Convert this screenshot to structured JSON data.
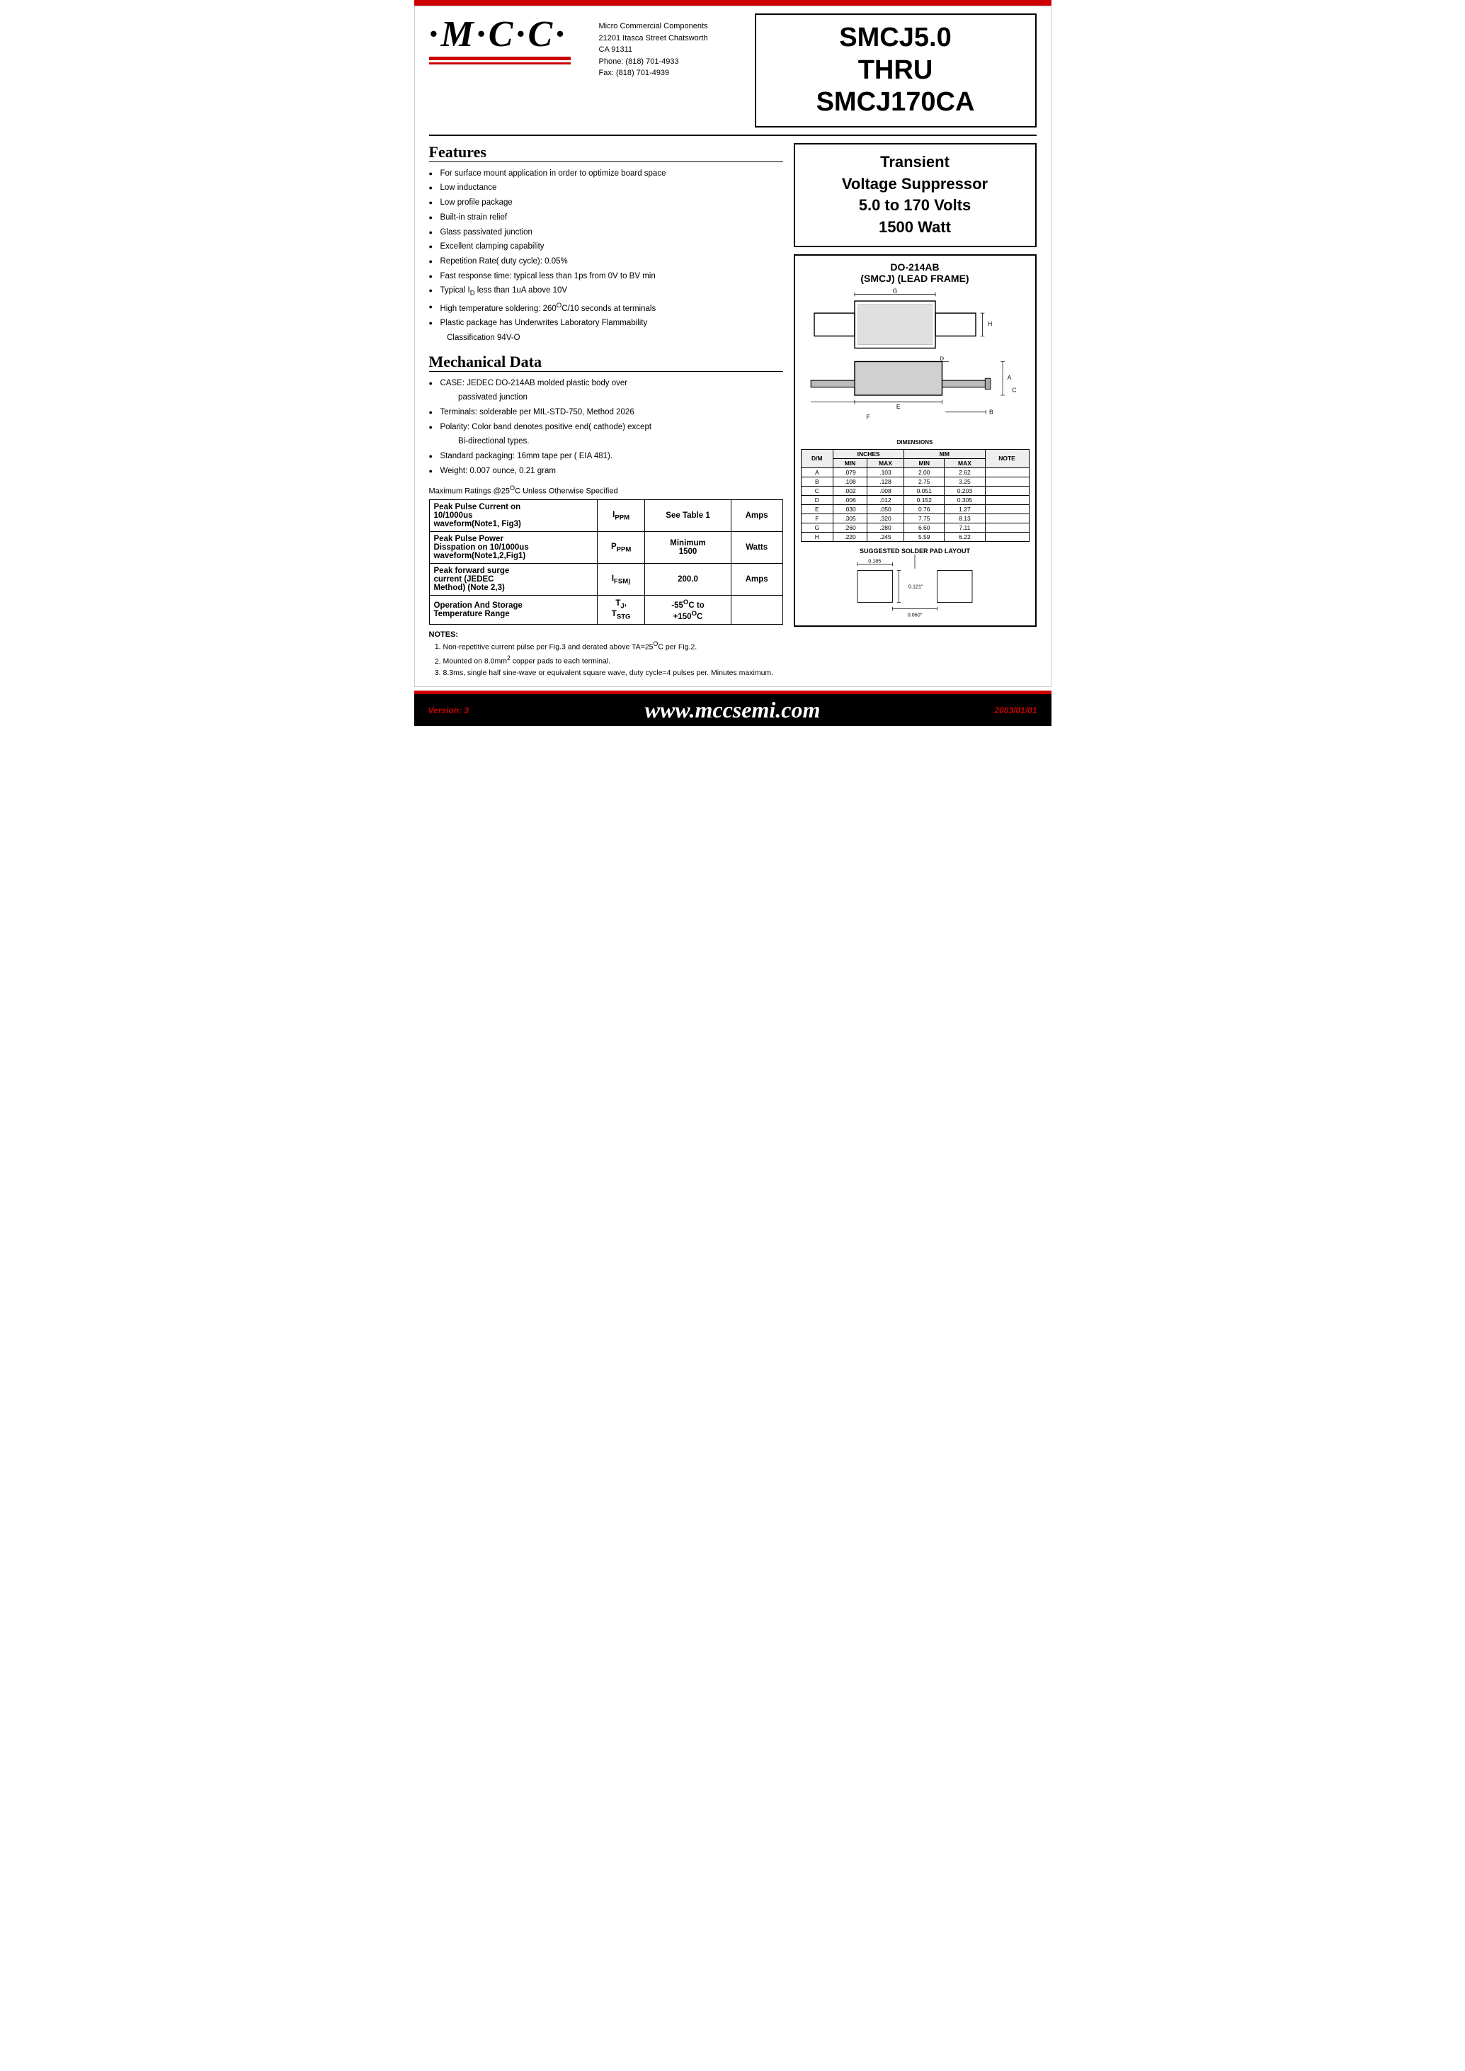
{
  "top_bar": {},
  "header": {
    "logo": "M·C·C·",
    "company_name": "Micro Commercial Components",
    "address1": "21201 Itasca Street Chatsworth",
    "address2": "CA 91311",
    "phone": "Phone: (818) 701-4933",
    "fax": "Fax:    (818) 701-4939",
    "part_number": "SMCJ5.0\nTHRU\nSMCJ170CA"
  },
  "product_description": {
    "line1": "Transient",
    "line2": "Voltage Suppressor",
    "line3": "5.0 to 170 Volts",
    "line4": "1500 Watt"
  },
  "package_info": {
    "title1": "DO-214AB",
    "title2": "(SMCJ) (LEAD FRAME)"
  },
  "features": {
    "section_title": "Features",
    "items": [
      "For surface mount application in order to optimize board space",
      "Low inductance",
      "Low profile package",
      "Built-in strain relief",
      "Glass passivated junction",
      "Excellent clamping capability",
      "Repetition Rate( duty cycle): 0.05%",
      "Fast response time: typical less than 1ps from 0V to BV min",
      "Typical I₀ less than 1uA above 10V",
      "High temperature soldering: 260°C/10 seconds at terminals",
      "Plastic package has Underwrites Laboratory Flammability Classification 94V-O"
    ]
  },
  "mechanical_data": {
    "section_title": "Mechanical Data",
    "items": [
      "CASE: JEDEC DO-214AB molded plastic body over passivated junction",
      "Terminals:  solderable per MIL-STD-750, Method 2026",
      "Polarity: Color band denotes positive end( cathode) except Bi-directional types.",
      "Standard packaging: 16mm tape per ( EIA 481).",
      "Weight: 0.007 ounce, 0.21 gram"
    ]
  },
  "max_ratings_label": "Maximum Ratings @25°C Unless Otherwise Specified",
  "ratings_table": {
    "rows": [
      {
        "col1": "Peak Pulse Current on 10/1000us waveform(Note1, Fig3)",
        "col2": "Iₚₚₘ",
        "col3": "See Table 1",
        "col4": "Amps"
      },
      {
        "col1": "Peak Pulse Power Disspation on 10/1000us waveform(Note1,2,Fig1)",
        "col2": "Pₚₚₘ",
        "col3": "Minimum 1500",
        "col4": "Watts"
      },
      {
        "col1": "Peak forward surge current (JEDEC Method) (Note 2,3)",
        "col2": "Iᴘₛₘ₋",
        "col3": "200.0",
        "col4": "Amps"
      },
      {
        "col1": "Operation And Storage Temperature Range",
        "col2": "Tⱼ, Tₛₜᴳ",
        "col3": "-55°C to +150°C",
        "col4": ""
      }
    ]
  },
  "notes": {
    "title": "NOTES:",
    "items": [
      "Non-repetitive current pulse per Fig.3 and derated above TA=25°C per Fig.2.",
      "Mounted on 8.0mm² copper pads to each terminal.",
      "8.3ms, single half sine-wave or equivalent square wave, duty cycle=4 pulses per. Minutes maximum."
    ]
  },
  "dimensions_table": {
    "headers": [
      "D/M",
      "INCHES MIN",
      "INCHES MAX",
      "MM MIN",
      "MM MAX",
      "NOTE"
    ],
    "rows": [
      [
        "A",
        ".079",
        ".103",
        "2.00",
        "2.62",
        ""
      ],
      [
        "B",
        ".108",
        ".128",
        "2.75",
        "3.25",
        ""
      ],
      [
        "C",
        ".002",
        ".008",
        "0.051",
        "0.203",
        ""
      ],
      [
        "D",
        ".006",
        ".012",
        "0.152",
        "0.305",
        ""
      ],
      [
        "E",
        ".030",
        ".050",
        "0.76",
        "1.27",
        ""
      ],
      [
        "F",
        ".305",
        ".320",
        "7.75",
        "8.13",
        ""
      ],
      [
        "G",
        ".260",
        ".280",
        "6.60",
        "7.11",
        ""
      ],
      [
        "H",
        ".220",
        ".245",
        "5.59",
        "6.22",
        ""
      ]
    ]
  },
  "solder_pad": {
    "title": "SUGGESTED SOLDER PAD LAYOUT",
    "dim1": "0.185",
    "dim2": "0.121\"",
    "dim3": "0.060\""
  },
  "footer": {
    "website": "www.mccsemi.com",
    "version_label": "Version: 3",
    "date_label": "2003/01/01"
  }
}
